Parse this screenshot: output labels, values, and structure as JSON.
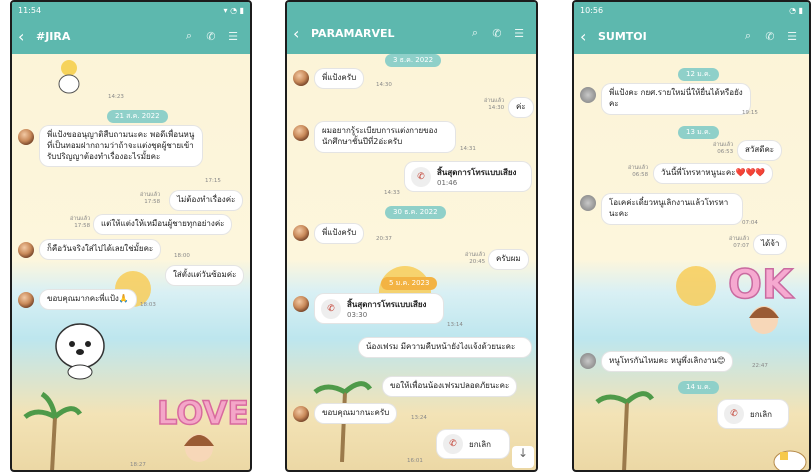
{
  "phone1": {
    "status_time": "11:54",
    "title": "#JIRA",
    "time_top": "14:23",
    "date1": "21 ส.ค. 2022",
    "msg1": "พี่แป้งขออนุญาติสืบถามนะคะ พอดีเพื่อนหนูที่เป็นทอมฝากถามว่าถ้าจะแต่งชุดผู้ชายเข้ารับปริญญาต้องทำเรื่องอะไรมั้ยคะ",
    "msg1_time": "17:15",
    "reply1_read": "อ่านแล้ว",
    "reply1_time": "17:58",
    "reply1": "ไม่ต้องทำเรื่องค่ะ",
    "reply2_read": "อ่านแล้ว",
    "reply2_time": "17:58",
    "reply2": "แต่ให้แต่งให้เหมือนผู้ชายทุกอย่างค่ะ",
    "msg2": "ก็คือวันจริงใส่ไปได้เลยใช่มั้ยคะ",
    "msg2_time": "18:00",
    "reply3": "ใส่ตั้งแต่วันซ้อมค่ะ",
    "msg3": "ขอบคุณมากคะพี่แป้ง🙏",
    "msg3_time": "18:03",
    "bottom_time": "18:27",
    "sticker_text": "LOVE"
  },
  "phone2": {
    "title": "PARAMARVEL",
    "date1": "3 ธ.ค. 2022",
    "msg1": "พี่แป้งครับ",
    "msg1_time": "14:30",
    "reply1_read": "อ่านแล้ว",
    "reply1_time": "14:30",
    "reply1": "ค่ะ",
    "msg2": "ผมอยากรู้ระเบียบการแต่งกายของนักศึกษาชั้นปีที่2อ่ะครับ",
    "msg2_time": "14:31",
    "call1_title": "สิ้นสุดการโทรแบบเสียง",
    "call1_dur": "01:46",
    "call1_time": "14:33",
    "date2": "30 ธ.ค. 2022",
    "msg3": "พี่แป้งครับ",
    "msg3_time": "20:37",
    "reply2_read": "อ่านแล้ว",
    "reply2_time": "20:45",
    "reply2": "ครับผม",
    "date3": "5 ม.ค. 2023",
    "call2_title": "สิ้นสุดการโทรแบบเสียง",
    "call2_dur": "03:30",
    "call2_time": "13:14",
    "reply3": "น้องเฟรม มีความคืบหน้ายังไงแจ้งด้วยนะคะ",
    "reply4": "ขอให้เพื่อนน้องเฟรมปลอดภัยนะคะ",
    "msg4": "ขอบคุณมากนะครับ",
    "msg4_time": "13:24",
    "call3_label": "ยกเลิก",
    "call3_time": "16:01"
  },
  "phone3": {
    "status_time": "10:56",
    "title": "SUMTOI",
    "date1": "12 ม.ค.",
    "msg1": "พี่แป้งคะ กยศ.รายใหม่นี่ให้ยื่นได้หรือยังคะ",
    "msg1_time": "19:15",
    "date2": "13 ม.ค.",
    "reply1_read": "อ่านแล้ว",
    "reply1_time": "06:53",
    "reply1": "สวัสดีคะ",
    "reply2_read": "อ่านแล้ว",
    "reply2_time": "06:58",
    "reply2": "วันนี้พี่โทรหาหนูนะคะ❤️❤️❤️",
    "msg2": "โอเคค่ะเดี๋ยวหนูเลิกงานแล้วโทรหานะคะ",
    "msg2_time": "07:04",
    "reply3_read": "อ่านแล้ว",
    "reply3_time": "07:07",
    "reply3": "ได้จ้า",
    "sticker_text": "OK",
    "msg3": "หนูโทรกันไหมคะ หนูพึ่งเลิกงาน😊",
    "msg3_time": "22:47",
    "date3": "14 ม.ค.",
    "call_label": "ยกเลิก"
  }
}
